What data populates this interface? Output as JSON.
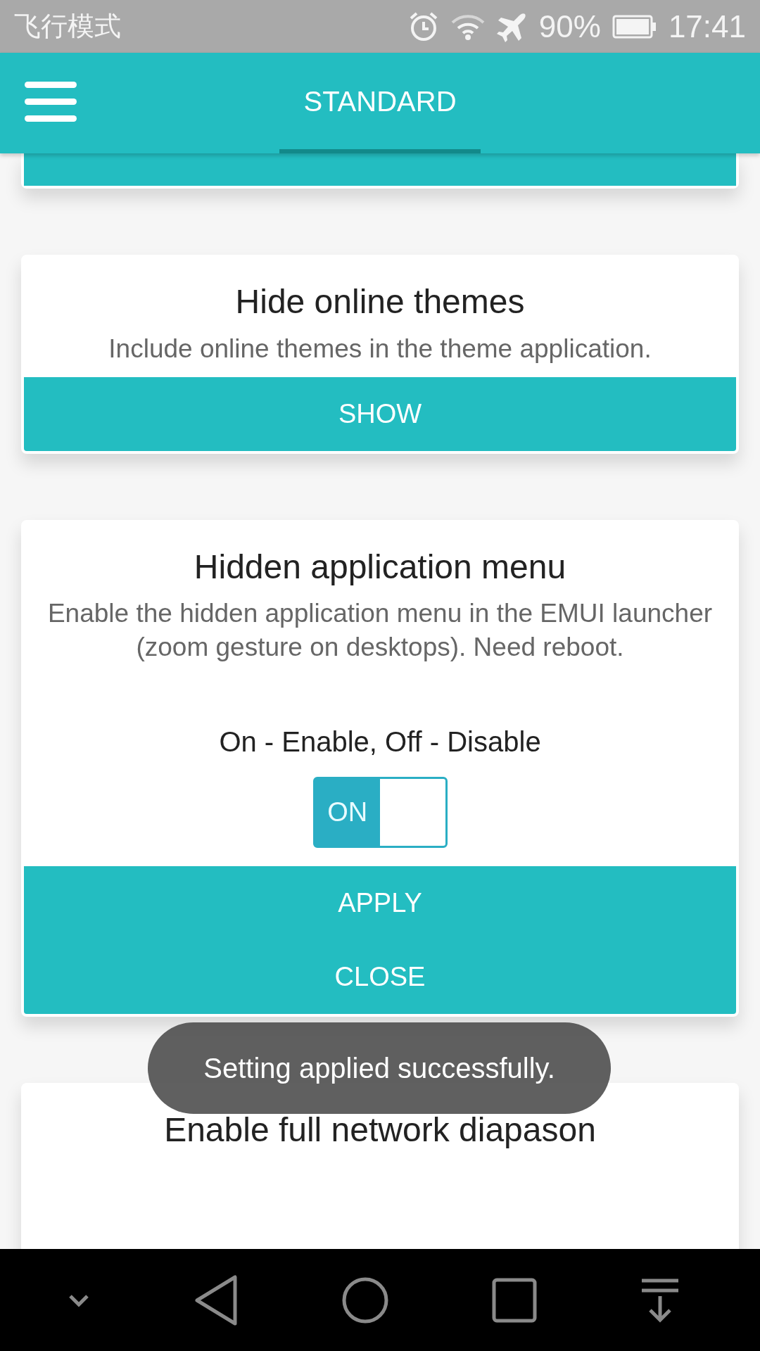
{
  "status_bar": {
    "mode_text": "飞行模式",
    "battery": "90%",
    "time": "17:41"
  },
  "header": {
    "tabs": [
      {
        "label": "STANDARD",
        "selected": true
      }
    ]
  },
  "cards": [
    {
      "title": "Hide online themes",
      "description": "Include online themes in the theme application.",
      "buttons": [
        "SHOW"
      ]
    },
    {
      "title": "Hidden application menu",
      "description": "Enable the hidden application menu in the EMUI launcher (zoom gesture on desktops). Need reboot.",
      "option_label": "On - Enable, Off - Disable",
      "toggle": {
        "label": "ON",
        "on": true
      },
      "buttons": [
        "APPLY",
        "CLOSE"
      ]
    },
    {
      "title": "Enable full network diapason"
    }
  ],
  "toast": {
    "text": "Setting applied successfully."
  }
}
